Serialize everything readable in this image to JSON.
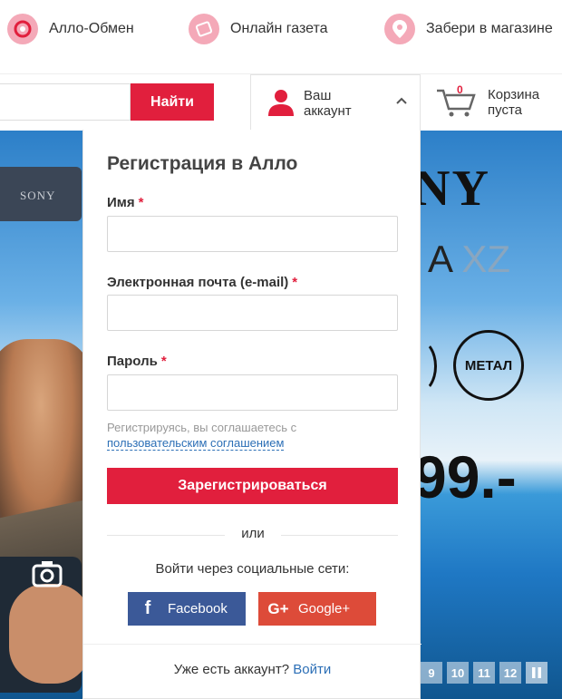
{
  "topbar": {
    "items": [
      {
        "label": "Алло-Обмен",
        "icon": "exchange-icon"
      },
      {
        "label": "Онлайн газета",
        "icon": "newspaper-icon"
      },
      {
        "label": "Забери в магазине",
        "icon": "location-pin-icon"
      }
    ]
  },
  "search": {
    "button_label": "Найти",
    "placeholder": ""
  },
  "account": {
    "line1": "Ваш",
    "line2": "аккаунт",
    "icon": "user-icon"
  },
  "cart": {
    "count": "0",
    "line1": "Корзина",
    "line2": "пуста",
    "icon": "cart-icon"
  },
  "banner": {
    "brand": "NY",
    "phone_brand": "SONY",
    "model_prefix": "A ",
    "model_suffix": "XZ",
    "badge": "МЕТАЛ",
    "price": "99.-",
    "pager": [
      "9",
      "10",
      "11",
      "12"
    ]
  },
  "registration": {
    "title": "Регистрация в Алло",
    "name_label": "Имя",
    "email_label": "Электронная почта (e-mail)",
    "password_label": "Пароль",
    "required_mark": "*",
    "agree_text": "Регистрируясь, вы соглашаетесь с",
    "agree_link": "пользовательским соглашением",
    "submit_label": "Зарегистрироваться",
    "or_text": "или",
    "social_title": "Войти через социальные сети:",
    "facebook_label": "Facebook",
    "facebook_icon_glyph": "f",
    "google_label": "Google+",
    "google_icon_glyph": "G+",
    "have_account_text": "Уже есть аккаунт?",
    "login_link": "Войти"
  },
  "colors": {
    "accent": "#e11f3d",
    "facebook": "#3b5998",
    "google": "#dd4b39",
    "link": "#2c6fb6"
  }
}
